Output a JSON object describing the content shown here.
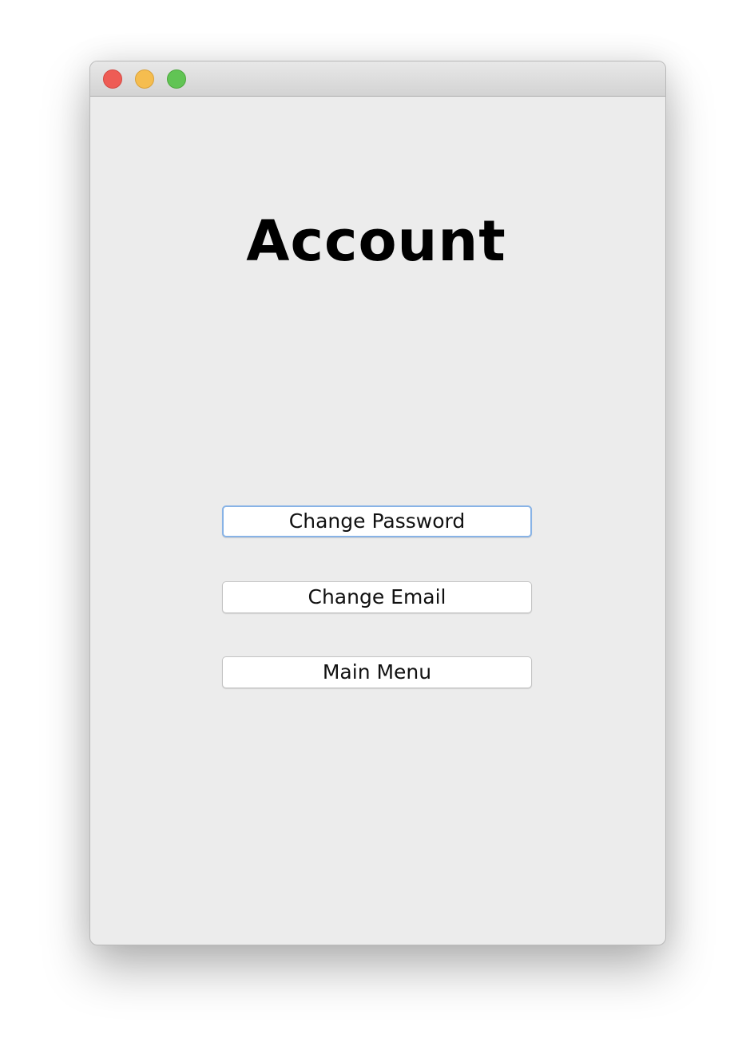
{
  "window": {
    "controls": {
      "close_color": "#ee5c55",
      "minimize_color": "#f5bd4f",
      "zoom_color": "#61c454"
    }
  },
  "main": {
    "title": "Account",
    "buttons": {
      "change_password": "Change Password",
      "change_email": "Change Email",
      "main_menu": "Main Menu"
    },
    "focused_button": "change_password",
    "focus_color": "#88b3e6"
  }
}
